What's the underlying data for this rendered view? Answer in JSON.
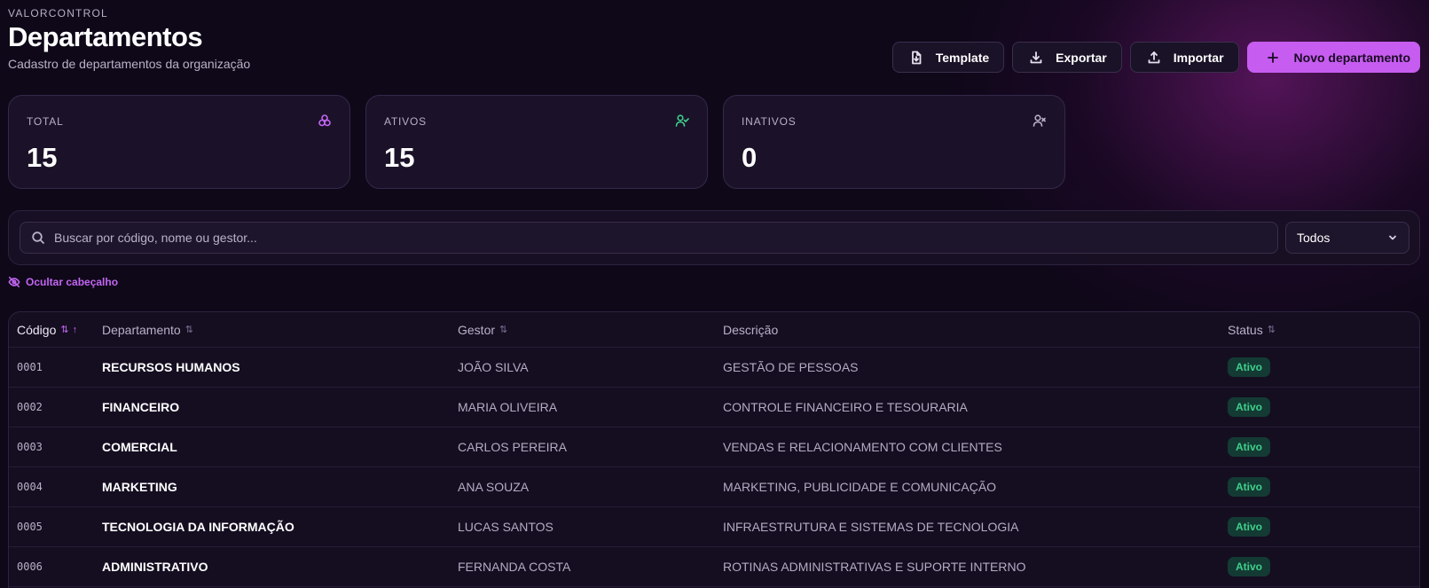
{
  "header": {
    "brand": "VALORCONTROL",
    "title": "Departamentos",
    "subtitle": "Cadastro de departamentos da organização"
  },
  "actions": {
    "template": "Template",
    "exportar": "Exportar",
    "importar": "Importar",
    "novo": "Novo departamento"
  },
  "stats": {
    "total": {
      "label": "TOTAL",
      "value": "15",
      "icon": "layers-icon",
      "color": "#c266f2"
    },
    "ativos": {
      "label": "ATIVOS",
      "value": "15",
      "icon": "user-check-icon",
      "color": "#3ed08a"
    },
    "inativos": {
      "label": "INATIVOS",
      "value": "0",
      "icon": "user-x-icon",
      "color": "#b9b2c8"
    }
  },
  "filters": {
    "search_placeholder": "Buscar por código, nome ou gestor...",
    "status_selected": "Todos"
  },
  "toggle_header_label": "Ocultar cabeçalho",
  "table": {
    "columns": {
      "codigo": "Código",
      "departamento": "Departamento",
      "gestor": "Gestor",
      "descricao": "Descrição",
      "status": "Status"
    },
    "rows": [
      {
        "codigo": "0001",
        "departamento": "RECURSOS HUMANOS",
        "gestor": "JOÃO SILVA",
        "descricao": "GESTÃO DE PESSOAS",
        "status": "Ativo"
      },
      {
        "codigo": "0002",
        "departamento": "FINANCEIRO",
        "gestor": "MARIA OLIVEIRA",
        "descricao": "CONTROLE FINANCEIRO E TESOURARIA",
        "status": "Ativo"
      },
      {
        "codigo": "0003",
        "departamento": "COMERCIAL",
        "gestor": "CARLOS PEREIRA",
        "descricao": "VENDAS E RELACIONAMENTO COM CLIENTES",
        "status": "Ativo"
      },
      {
        "codigo": "0004",
        "departamento": "MARKETING",
        "gestor": "ANA SOUZA",
        "descricao": "MARKETING, PUBLICIDADE E COMUNICAÇÃO",
        "status": "Ativo"
      },
      {
        "codigo": "0005",
        "departamento": "TECNOLOGIA DA INFORMAÇÃO",
        "gestor": "LUCAS SANTOS",
        "descricao": "INFRAESTRUTURA E SISTEMAS DE TECNOLOGIA",
        "status": "Ativo"
      },
      {
        "codigo": "0006",
        "departamento": "ADMINISTRATIVO",
        "gestor": "FERNANDA COSTA",
        "descricao": "ROTINAS ADMINISTRATIVAS E SUPORTE INTERNO",
        "status": "Ativo"
      }
    ]
  }
}
